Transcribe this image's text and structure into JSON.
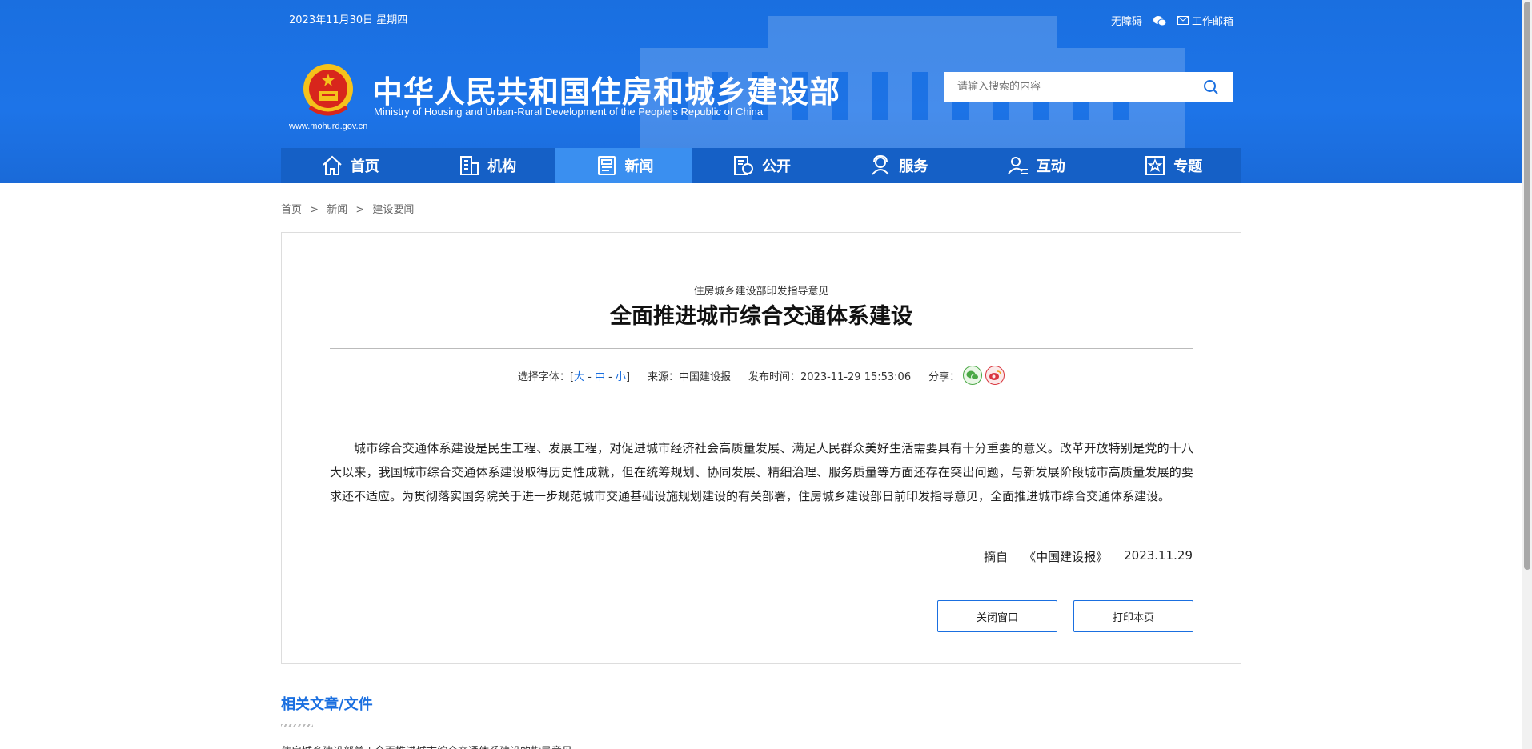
{
  "header": {
    "date": "2023年11月30日 星期四",
    "links": {
      "accessibility": "无障碍",
      "email": "工作邮箱"
    },
    "site_title": "中华人民共和国住房和城乡建设部",
    "site_subtitle": "Ministry of Housing and Urban-Rural Development of the People’s Republic of China",
    "site_url": "www.mohurd.gov.cn",
    "search_placeholder": "请输入搜索的内容"
  },
  "nav": {
    "items": [
      {
        "label": "首页",
        "icon": "home-icon"
      },
      {
        "label": "机构",
        "icon": "building-icon"
      },
      {
        "label": "新闻",
        "icon": "news-icon",
        "active": true
      },
      {
        "label": "公开",
        "icon": "disclosure-icon"
      },
      {
        "label": "服务",
        "icon": "service-icon"
      },
      {
        "label": "互动",
        "icon": "interaction-icon"
      },
      {
        "label": "专题",
        "icon": "topic-icon"
      }
    ]
  },
  "breadcrumb": {
    "items": [
      "首页",
      "新闻",
      "建设要闻"
    ],
    "separator": ">"
  },
  "article": {
    "kicker": "住房城乡建设部印发指导意见",
    "title": "全面推进城市综合交通体系建设",
    "meta": {
      "font_label": "选择字体：",
      "font_large": "大",
      "font_medium": "中",
      "font_small": "小",
      "source": "来源：中国建设报",
      "published": "发布时间：2023-11-29 15:53:06",
      "share_label": "分享："
    },
    "body": "城市综合交通体系建设是民生工程、发展工程，对促进城市经济社会高质量发展、满足人民群众美好生活需要具有十分重要的意义。改革开放特别是党的十八大以来，我国城市综合交通体系建设取得历史性成就，但在统筹规划、协同发展、精细治理、服务质量等方面还存在突出问题，与新发展阶段城市高质量发展的要求还不适应。为贯彻落实国务院关于进一步规范城市交通基础设施规划建设的有关部署，住房城乡建设部日前印发指导意见，全面推进城市综合交通体系建设。",
    "excerpt_from": "摘自",
    "excerpt_source": "《中国建设报》",
    "excerpt_date": "2023.11.29",
    "close_button": "关闭窗口",
    "print_button": "打印本页"
  },
  "related": {
    "title": "相关文章/文件",
    "first_item": "住房城乡建设部关于全面推进城市综合交通体系建设的指导意见"
  },
  "colors": {
    "brand_blue": "#1d74e8",
    "nav_blue": "#1560c6",
    "nav_active": "#3a8ff0",
    "link_blue": "#1a6fe0"
  }
}
